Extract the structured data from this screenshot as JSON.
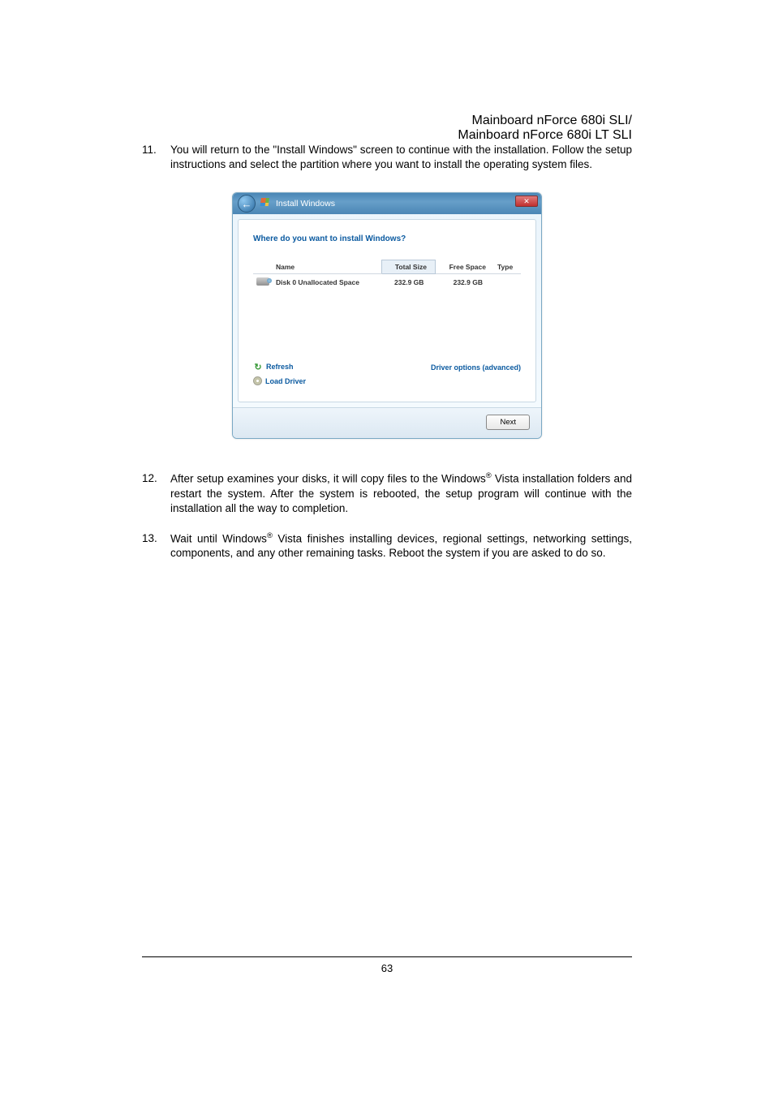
{
  "header": {
    "line1": "Mainboard nForce 680i SLI/ ",
    "line2": "Mainboard nForce 680i LT SLI"
  },
  "steps": {
    "s11": {
      "num": "11.",
      "text": "You will return to the \"Install Windows\" screen to continue with the installation. Follow the setup instructions and select the partition where you want to install the operating system files."
    },
    "s12": {
      "num": "12.",
      "text_a": "After setup examines your disks, it will copy files to the Windows",
      "text_b": " Vista installation folders and restart the system. After the system is rebooted, the setup program will continue with the installation all the way to completion."
    },
    "s13": {
      "num": "13.",
      "text_a": "Wait until Windows",
      "text_b": " Vista finishes installing devices, regional settings, networking settings, components, and any other remaining tasks. Reboot the system if you are asked to do so."
    }
  },
  "dialog": {
    "title": "Install Windows",
    "prompt": "Where do you want to install Windows?",
    "columns": {
      "name": "Name",
      "total": "Total Size",
      "free": "Free Space",
      "type": "Type"
    },
    "row": {
      "name": "Disk 0 Unallocated Space",
      "total": "232.9 GB",
      "free": "232.9 GB",
      "type": ""
    },
    "refresh": "Refresh",
    "load_driver": "Load Driver",
    "drive_options": "Driver options (advanced)",
    "next": "Next"
  },
  "footer": {
    "pagenum": "63"
  }
}
